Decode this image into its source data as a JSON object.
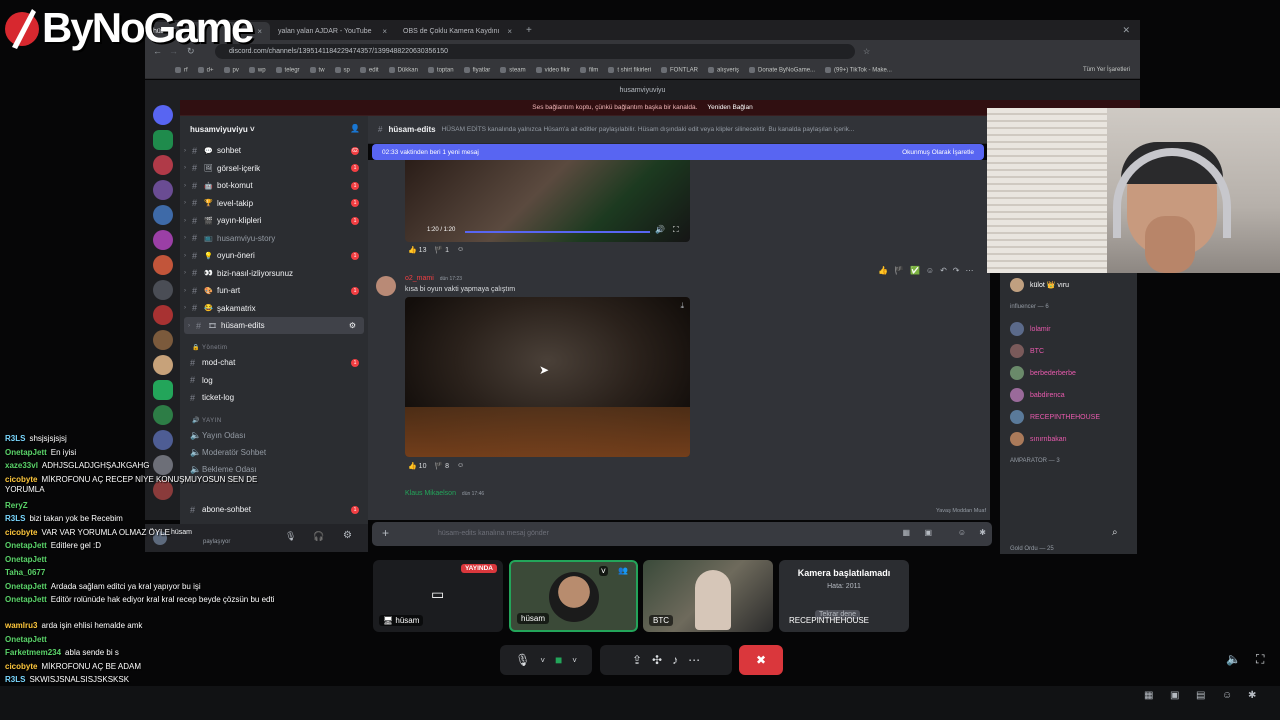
{
  "overlay": {
    "logo": "ByNoGame"
  },
  "browser": {
    "tabs": [
      {
        "label": "hüsam",
        "active": true
      },
      {
        "label": "yalan yalan AJDAR - YouTube",
        "active": false
      },
      {
        "label": "OBS de Çoklu Kamera Kaydını",
        "active": false
      }
    ],
    "url": "discord.com/channels/1395141184229474357/1399488220630356150",
    "bookmarks": [
      "rf",
      "d+",
      "pv",
      "wp",
      "telegr",
      "tw",
      "sp",
      "edit",
      "Dükkan",
      "toptan",
      "fiyatlar",
      "steam",
      "video fikir",
      "film",
      "t shirt fikirleri",
      "FONTLAR",
      "alışveriş",
      "Donate ByNoGame...",
      "(99+) TikTok - Make..."
    ],
    "bookmarks_right": "Tüm Yer İşaretleri"
  },
  "discord": {
    "window_title": "husamviyuviyu",
    "notice": "Ses bağlantım koptu, çünkü bağlantım başka bir kanalda.",
    "notice_action": "Yeniden Bağlan",
    "server_name": "husamviyuviyu",
    "channels": [
      {
        "emoji": "💬",
        "name": "sohbet",
        "badge": "62",
        "bright": true
      },
      {
        "emoji": "🖼",
        "name": "görsel-içerik",
        "badge": "1",
        "bright": true
      },
      {
        "emoji": "🤖",
        "name": "bot-komut",
        "badge": "1",
        "bright": true
      },
      {
        "emoji": "🏆",
        "name": "level-takip",
        "badge": "1",
        "bright": true
      },
      {
        "emoji": "🎬",
        "name": "yayın-klipleri",
        "badge": "1",
        "bright": true
      },
      {
        "emoji": "📺",
        "name": "husamviyu-story",
        "badge": "",
        "bright": false
      },
      {
        "emoji": "💡",
        "name": "oyun-öneri",
        "badge": "1",
        "bright": true
      },
      {
        "emoji": "👀",
        "name": "bizi-nasıl-izliyorsunuz",
        "badge": "",
        "bright": true
      },
      {
        "emoji": "🎨",
        "name": "fun-art",
        "badge": "1",
        "bright": true
      },
      {
        "emoji": "😂",
        "name": "şakamatrix",
        "badge": "",
        "bright": true
      },
      {
        "emoji": "🎞",
        "name": "hüsam-edits",
        "badge": "",
        "bright": true,
        "selected": true
      }
    ],
    "category_admin": "Yönetim",
    "admin_channels": [
      {
        "name": "mod-chat",
        "badge": "1"
      },
      {
        "name": "log",
        "badge": ""
      },
      {
        "name": "ticket-log",
        "badge": ""
      }
    ],
    "category_stream": "YAYIN",
    "voice_channels": [
      "Yayın Odası",
      "Moderatör Sohbet",
      "Bekleme Odası"
    ],
    "last_channel": {
      "name": "abone-sohbet",
      "badge": "1"
    },
    "user_name": "hüsam",
    "user_status": "paylaşıyor",
    "channel_header": "hüsam-edits",
    "channel_topic": "HÜSAM EDİTS kanalında yalnızca Hüsam'a ait editler paylaşılabilir. Hüsam dışındaki edit veya klipler silinecektir. Bu kanalda paylaşılan içerik...",
    "new_messages": "02:33 vaktinden beri 1 yeni mesaj",
    "mark_read": "Okunmuş Olarak İşaretle",
    "video1_time": "1:20 / 1:20",
    "reactions1": [
      "13",
      "1"
    ],
    "message_author": "o2_mami",
    "message_time": "dün 17:23",
    "message_text": "kısa bi oyun vakti yapmaya çalıştım",
    "reactions2": [
      "10",
      "8"
    ],
    "next_author": "Klaus Mikaelson",
    "next_time": "dün 17:46",
    "slowmode": "Yavaş Moddan Muaf",
    "input_placeholder": "hüsam-edits kanalına mesaj gönder",
    "members": [
      {
        "name": "külot 👑 vıru",
        "color": "#ffffff"
      },
      {
        "name": "influencer — 6",
        "group": true
      },
      {
        "name": "lolamir",
        "color": "#e85aad"
      },
      {
        "name": "BTC",
        "color": "#e85aad"
      },
      {
        "name": "berbederberbe",
        "color": "#e85aad"
      },
      {
        "name": "babdirenca",
        "color": "#e85aad"
      },
      {
        "name": "RECEPINTHEHOUSE",
        "color": "#e85aad"
      },
      {
        "name": "sınırnbakan",
        "color": "#e85aad"
      },
      {
        "name": "AMPARATOR — 3",
        "group": true
      }
    ],
    "member_footer": "Gold Ordu — 25"
  },
  "call": {
    "live_badge": "YAYINDA",
    "tiles": [
      {
        "name": "hüsam"
      },
      {
        "name": "hüsam"
      },
      {
        "name": "BTC"
      },
      {
        "name": "RECEPINTHEHOUSE"
      }
    ],
    "camera_error_title": "Kamera başlatılamadı",
    "camera_error_code": "Hata: 2011",
    "retry": "Tekrar dene"
  },
  "twitch_chat": [
    {
      "user": "R3LS",
      "color": "#7bd8ff",
      "msg": "shsjsjsjsjsj"
    },
    {
      "user": "OnetapJett",
      "color": "#5bd46a",
      "msg": "En iyisi"
    },
    {
      "user": "xaze33vl",
      "color": "#5bd46a",
      "msg": "ADHJSGLADJGHŞAJKGAHG"
    },
    {
      "user": "cicobyte",
      "color": "#ffc83d",
      "msg": "MİKROFONU AÇ RECEP NİYE KONUŞMUYOSUN SEN DE YORUMLA"
    },
    {
      "user": "ReryZ",
      "color": "#5bd46a",
      "msg": ""
    },
    {
      "user": "R3LS",
      "color": "#7bd8ff",
      "msg": "bizi takan yok be Recebim"
    },
    {
      "user": "cicobyte",
      "color": "#ffc83d",
      "msg": "VAR VAR YORUMLA OLMAZ ÖYLE"
    },
    {
      "user": "OnetapJett",
      "color": "#5bd46a",
      "msg": "Editlere gel :D"
    },
    {
      "user": "OnetapJett",
      "color": "#5bd46a",
      "msg": ""
    },
    {
      "user": "Taha_0677",
      "color": "#5bd46a",
      "msg": ""
    },
    {
      "user": "OnetapJett",
      "color": "#5bd46a",
      "msg": "Ardada sağlam editci ya kral yapıyor bu işi"
    },
    {
      "user": "OnetapJett",
      "color": "#5bd46a",
      "msg": "Editör rolünüde hak ediyor kral kral recep beyde çözsün bu edti"
    },
    {
      "user": "wamlru3",
      "color": "#ffc83d",
      "msg": "arda işin ehlisi hemalde amk"
    },
    {
      "user": "OnetapJett",
      "color": "#5bd46a",
      "msg": ""
    },
    {
      "user": "Farketmem234",
      "color": "#5bd46a",
      "msg": "abla sende bi s"
    },
    {
      "user": "cicobyte",
      "color": "#ffc83d",
      "msg": "MİKROFONU AÇ BE ADAM"
    },
    {
      "user": "R3LS",
      "color": "#7bd8ff",
      "msg": "SKWISJSNALSISJSKSKSK"
    }
  ]
}
